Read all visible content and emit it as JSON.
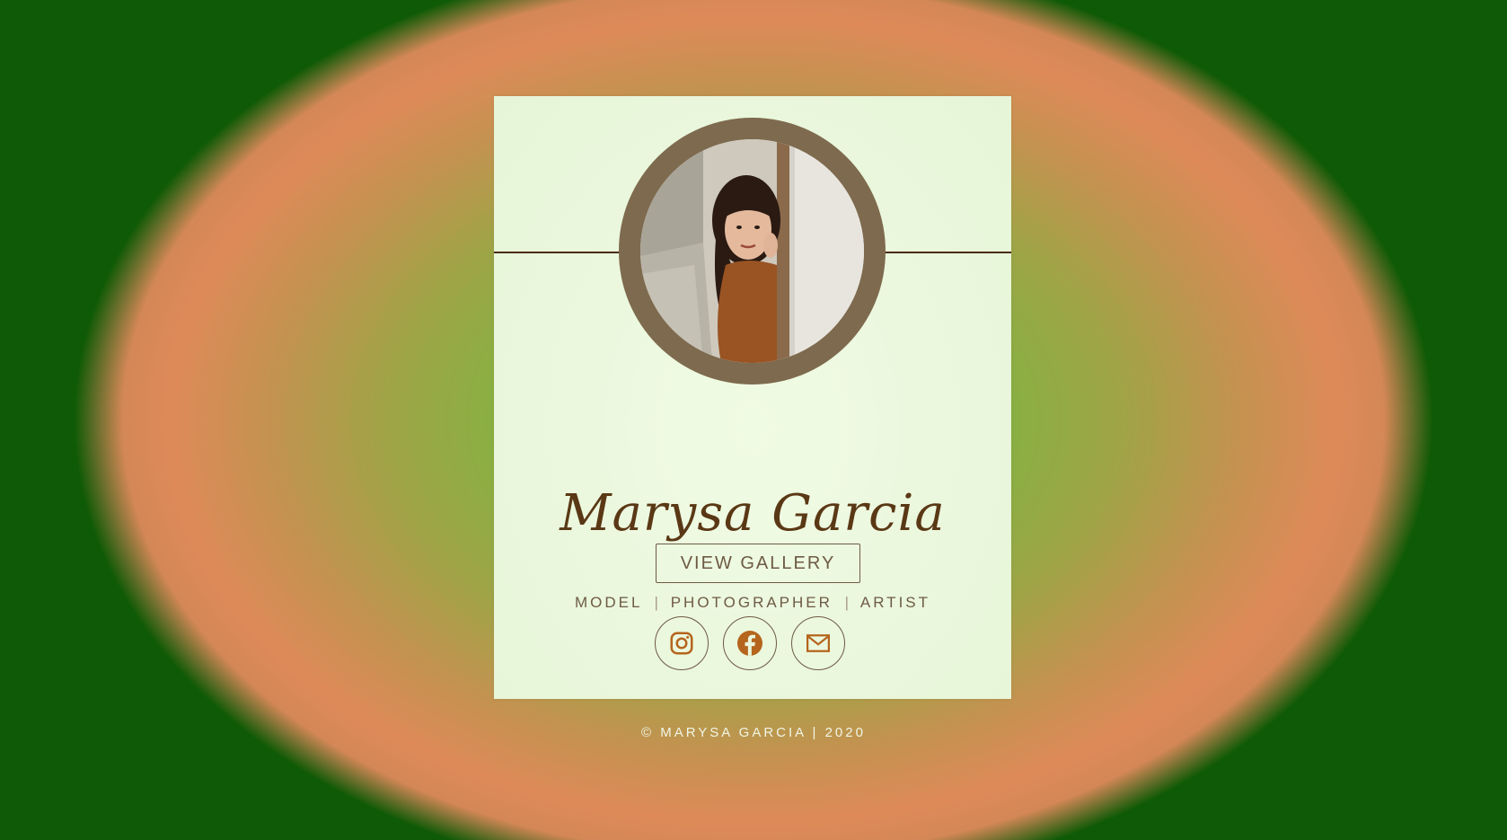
{
  "profile": {
    "name": "Marysa Garcia",
    "roles": [
      "MODEL",
      "PHOTOGRAPHER",
      "ARTIST"
    ],
    "role_separator": "|",
    "photo_alt": "Portrait of Marysa Garcia"
  },
  "actions": {
    "gallery_label": "VIEW GALLERY"
  },
  "socials": [
    {
      "icon": "instagram-icon"
    },
    {
      "icon": "facebook-icon"
    },
    {
      "icon": "mail-icon"
    }
  ],
  "footer": {
    "copyright": "© MARYSA GARCIA",
    "separator": "|",
    "year": "2020"
  },
  "colors": {
    "accent_brown": "#6e5a44",
    "icon_orange": "#b5651d",
    "ring": "#7e6a4e",
    "card_bg": "#eaf7dc",
    "outer_green": "#0f5a06",
    "ring_orange": "#de8a58",
    "center_green": "#7fc84a"
  }
}
